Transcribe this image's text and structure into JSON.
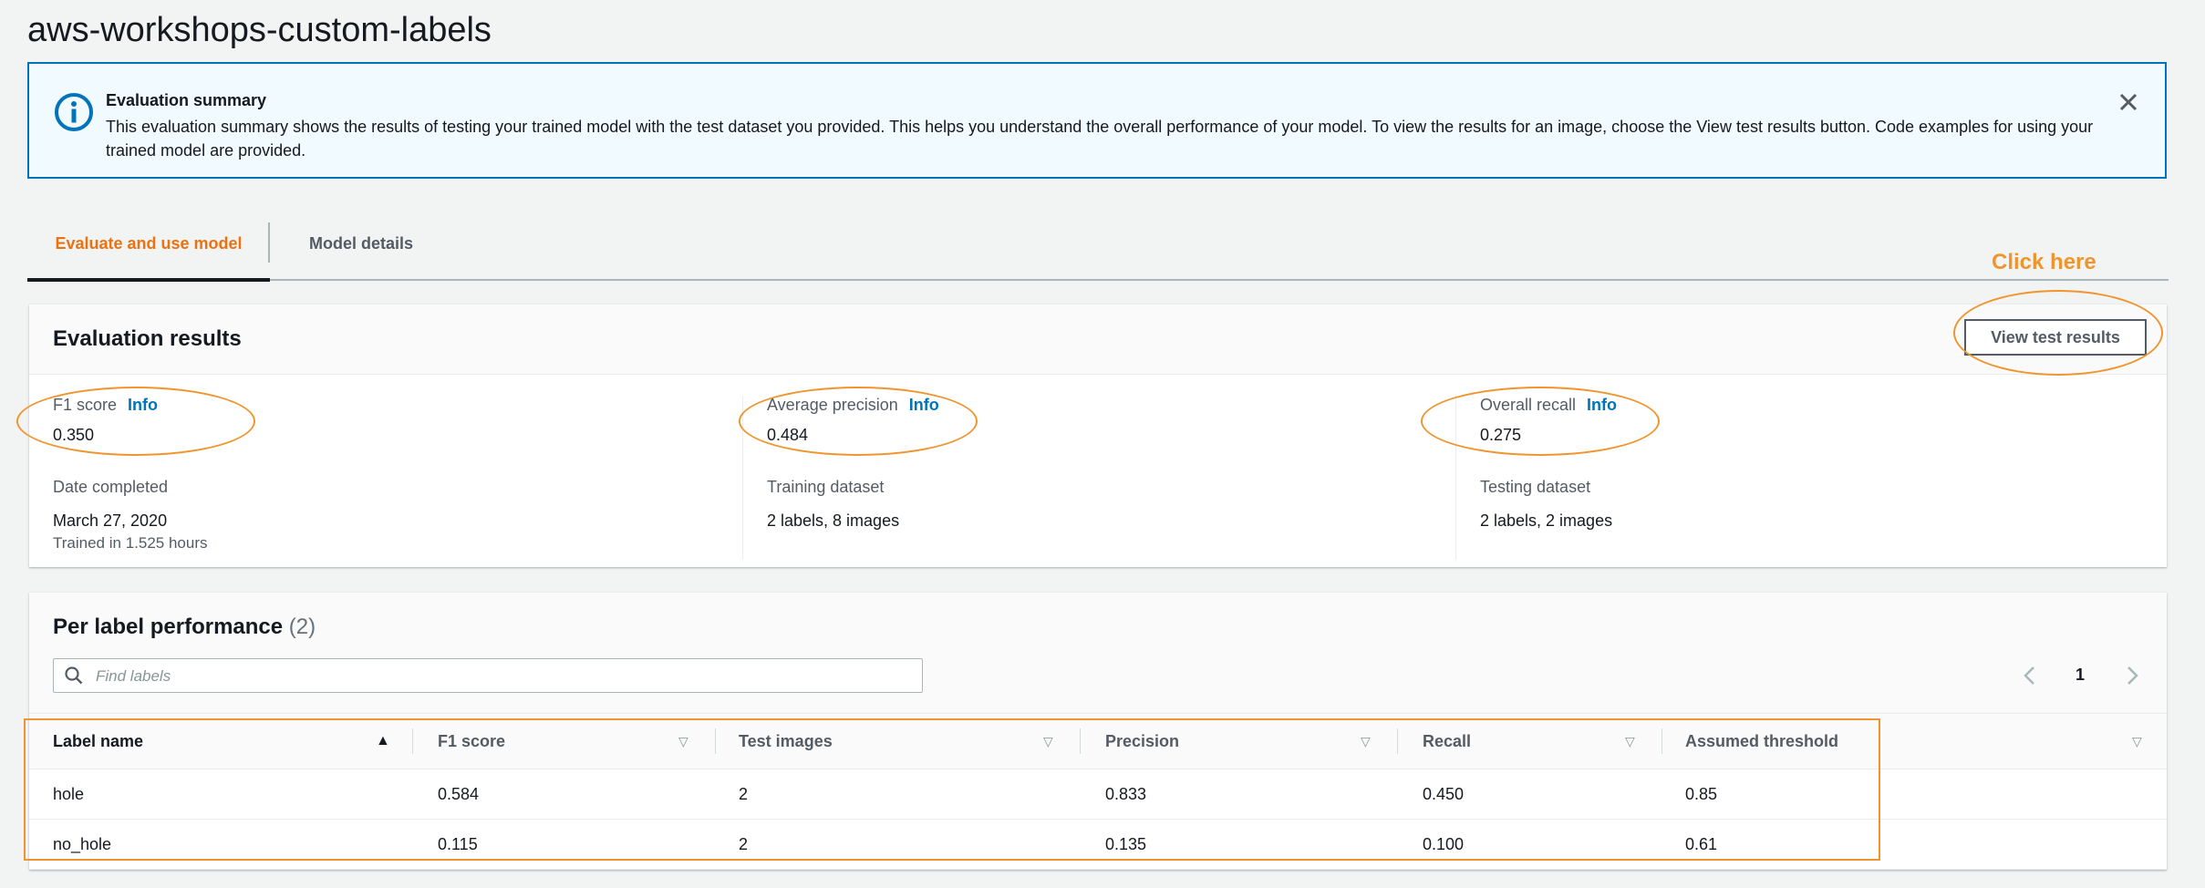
{
  "page": {
    "title": "aws-workshops-custom-labels"
  },
  "banner": {
    "icon": "info-icon",
    "title": "Evaluation summary",
    "body": "This evaluation summary shows the results of testing your trained model with the test dataset you provided. This helps you understand the overall performance of your model. To view the results for an image, choose the View test results button. Code examples for using your trained model are provided.",
    "close_icon": "close-icon",
    "accent": "#0073bb"
  },
  "tabs": [
    {
      "label": "Evaluate and use model",
      "active": true
    },
    {
      "label": "Model details",
      "active": false
    }
  ],
  "annotation": {
    "callout": "Click here",
    "color": "#f0952e"
  },
  "evaluation": {
    "title": "Evaluation results",
    "button_label": "View test results",
    "metrics": [
      {
        "label": "F1 score",
        "info": "Info",
        "value": "0.350",
        "sub_label": "Date completed",
        "sub_value": "March 27, 2020",
        "sub_note": "Trained in 1.525 hours"
      },
      {
        "label": "Average precision",
        "info": "Info",
        "value": "0.484",
        "sub_label": "Training dataset",
        "sub_value": "2 labels, 8 images"
      },
      {
        "label": "Overall recall",
        "info": "Info",
        "value": "0.275",
        "sub_label": "Testing dataset",
        "sub_value": "2 labels, 2 images"
      }
    ]
  },
  "per_label": {
    "title": "Per label performance",
    "count": "(2)",
    "search_placeholder": "Find labels",
    "page": "1",
    "columns": [
      "Label name",
      "F1 score",
      "Test images",
      "Precision",
      "Recall",
      "Assumed threshold"
    ],
    "rows": [
      [
        "hole",
        "0.584",
        "2",
        "0.833",
        "0.450",
        "0.85"
      ],
      [
        "no_hole",
        "0.115",
        "2",
        "0.135",
        "0.100",
        "0.61"
      ]
    ]
  }
}
